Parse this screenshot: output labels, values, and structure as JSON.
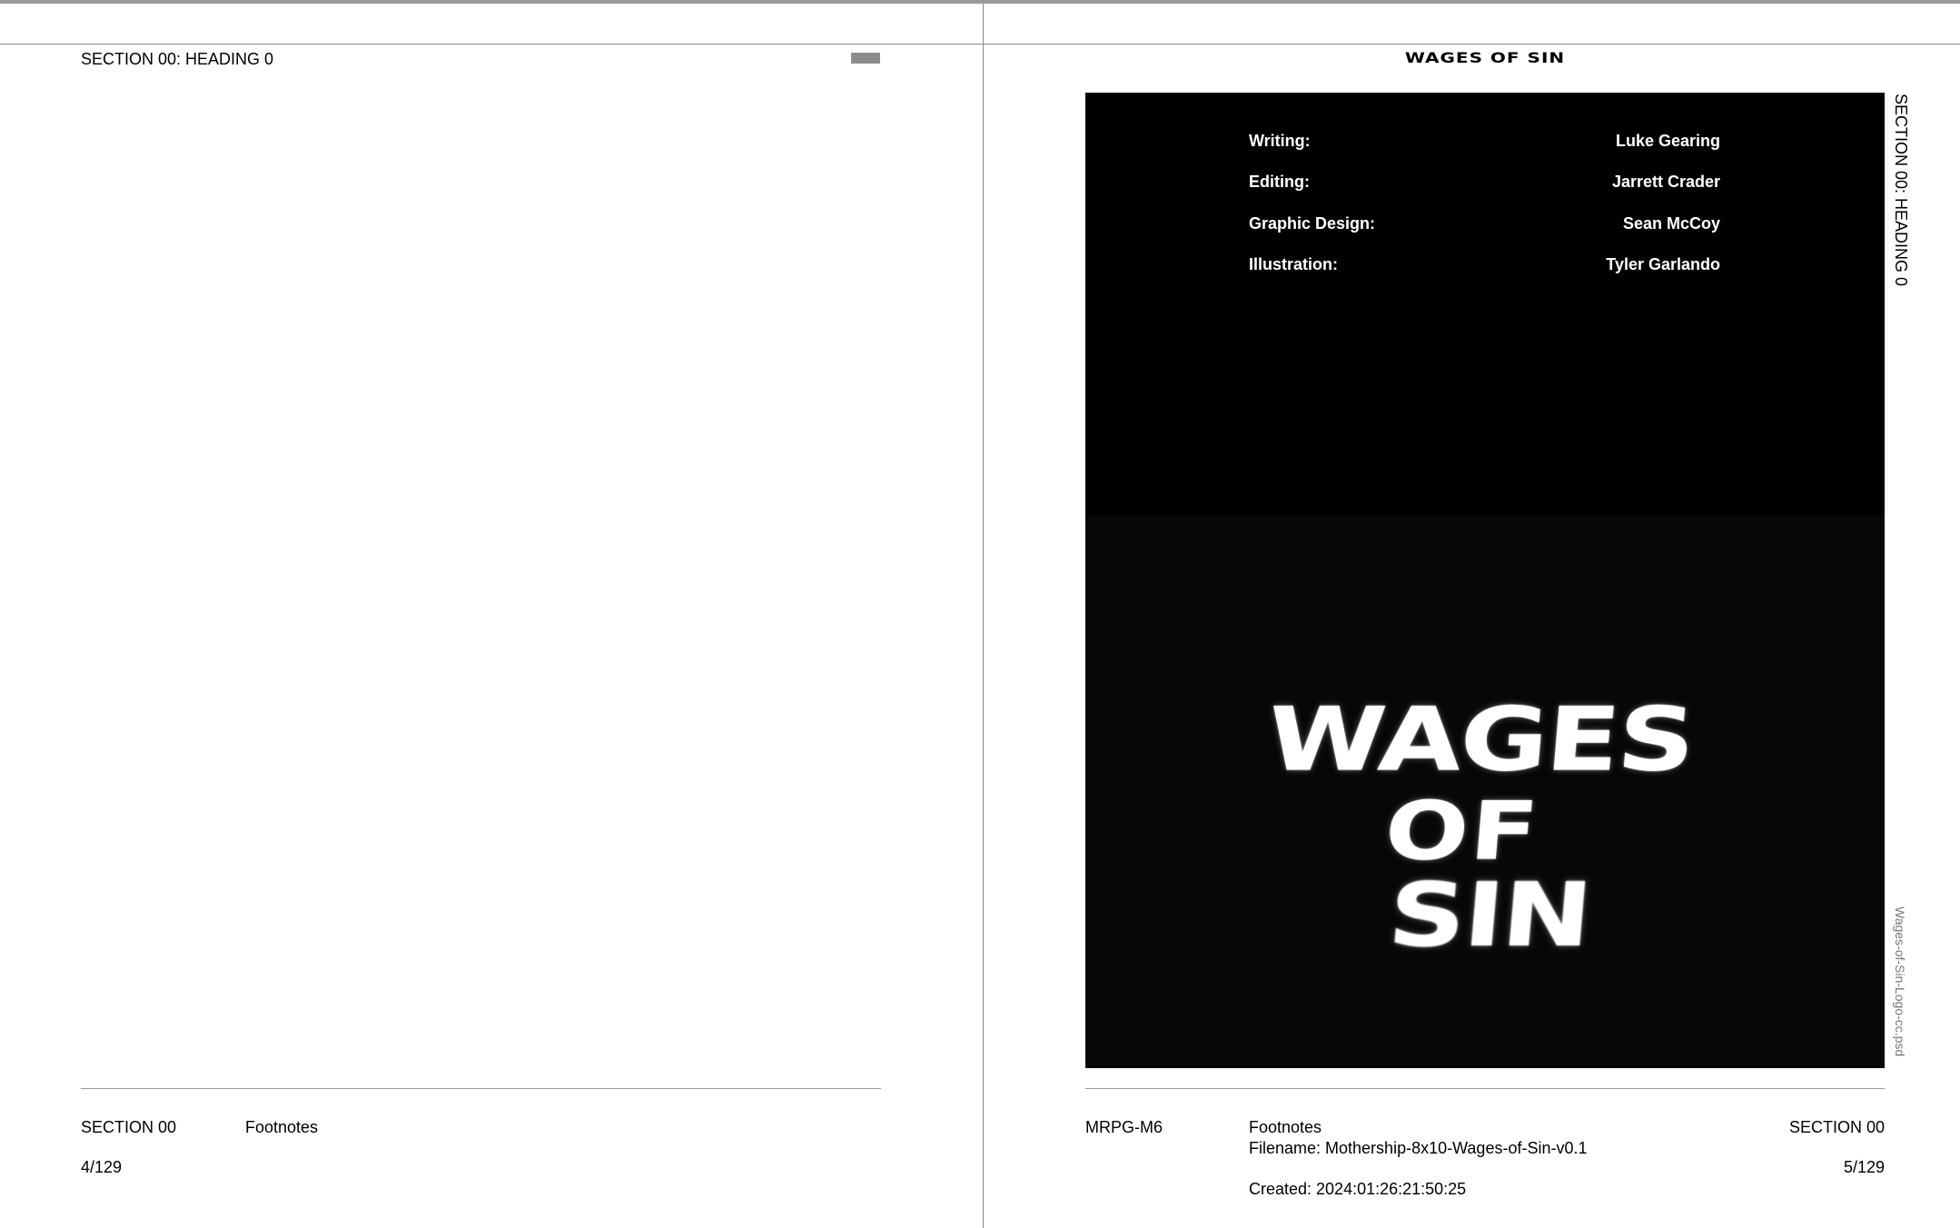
{
  "left_page": {
    "running_head": "SECTION 00: HEADING 0",
    "footer": {
      "section": "SECTION 00",
      "footnotes": "Footnotes",
      "page_number": "4/129"
    }
  },
  "right_page": {
    "running_title": "WAGES OF SIN",
    "vertical_running_head": "SECTION 00: HEADING 0",
    "credits": [
      {
        "label": "Writing:",
        "value": "Luke Gearing"
      },
      {
        "label": "Editing:",
        "value": "Jarrett Crader"
      },
      {
        "label": "Graphic Design:",
        "value": "Sean McCoy"
      },
      {
        "label": "Illustration:",
        "value": "Tyler Garlando"
      }
    ],
    "logo_lines": [
      "WAGES",
      "OF",
      "SIN"
    ],
    "image_filename": "Wages-of-Sin-Logo-cc.psd",
    "footer": {
      "code": "MRPG-M6",
      "footnotes": "Footnotes",
      "filename": "Filename: Mothership-8x10-Wages-of-Sin-v0.1",
      "created": "Created: 2024:01:26:21:50:25",
      "section": "SECTION 00",
      "page_number": "5/129"
    }
  },
  "colors": {
    "cover_background": "#000000",
    "cover_text": "#ffffff",
    "rule": "#9a9a9a",
    "marker": "#8c8c8c"
  }
}
